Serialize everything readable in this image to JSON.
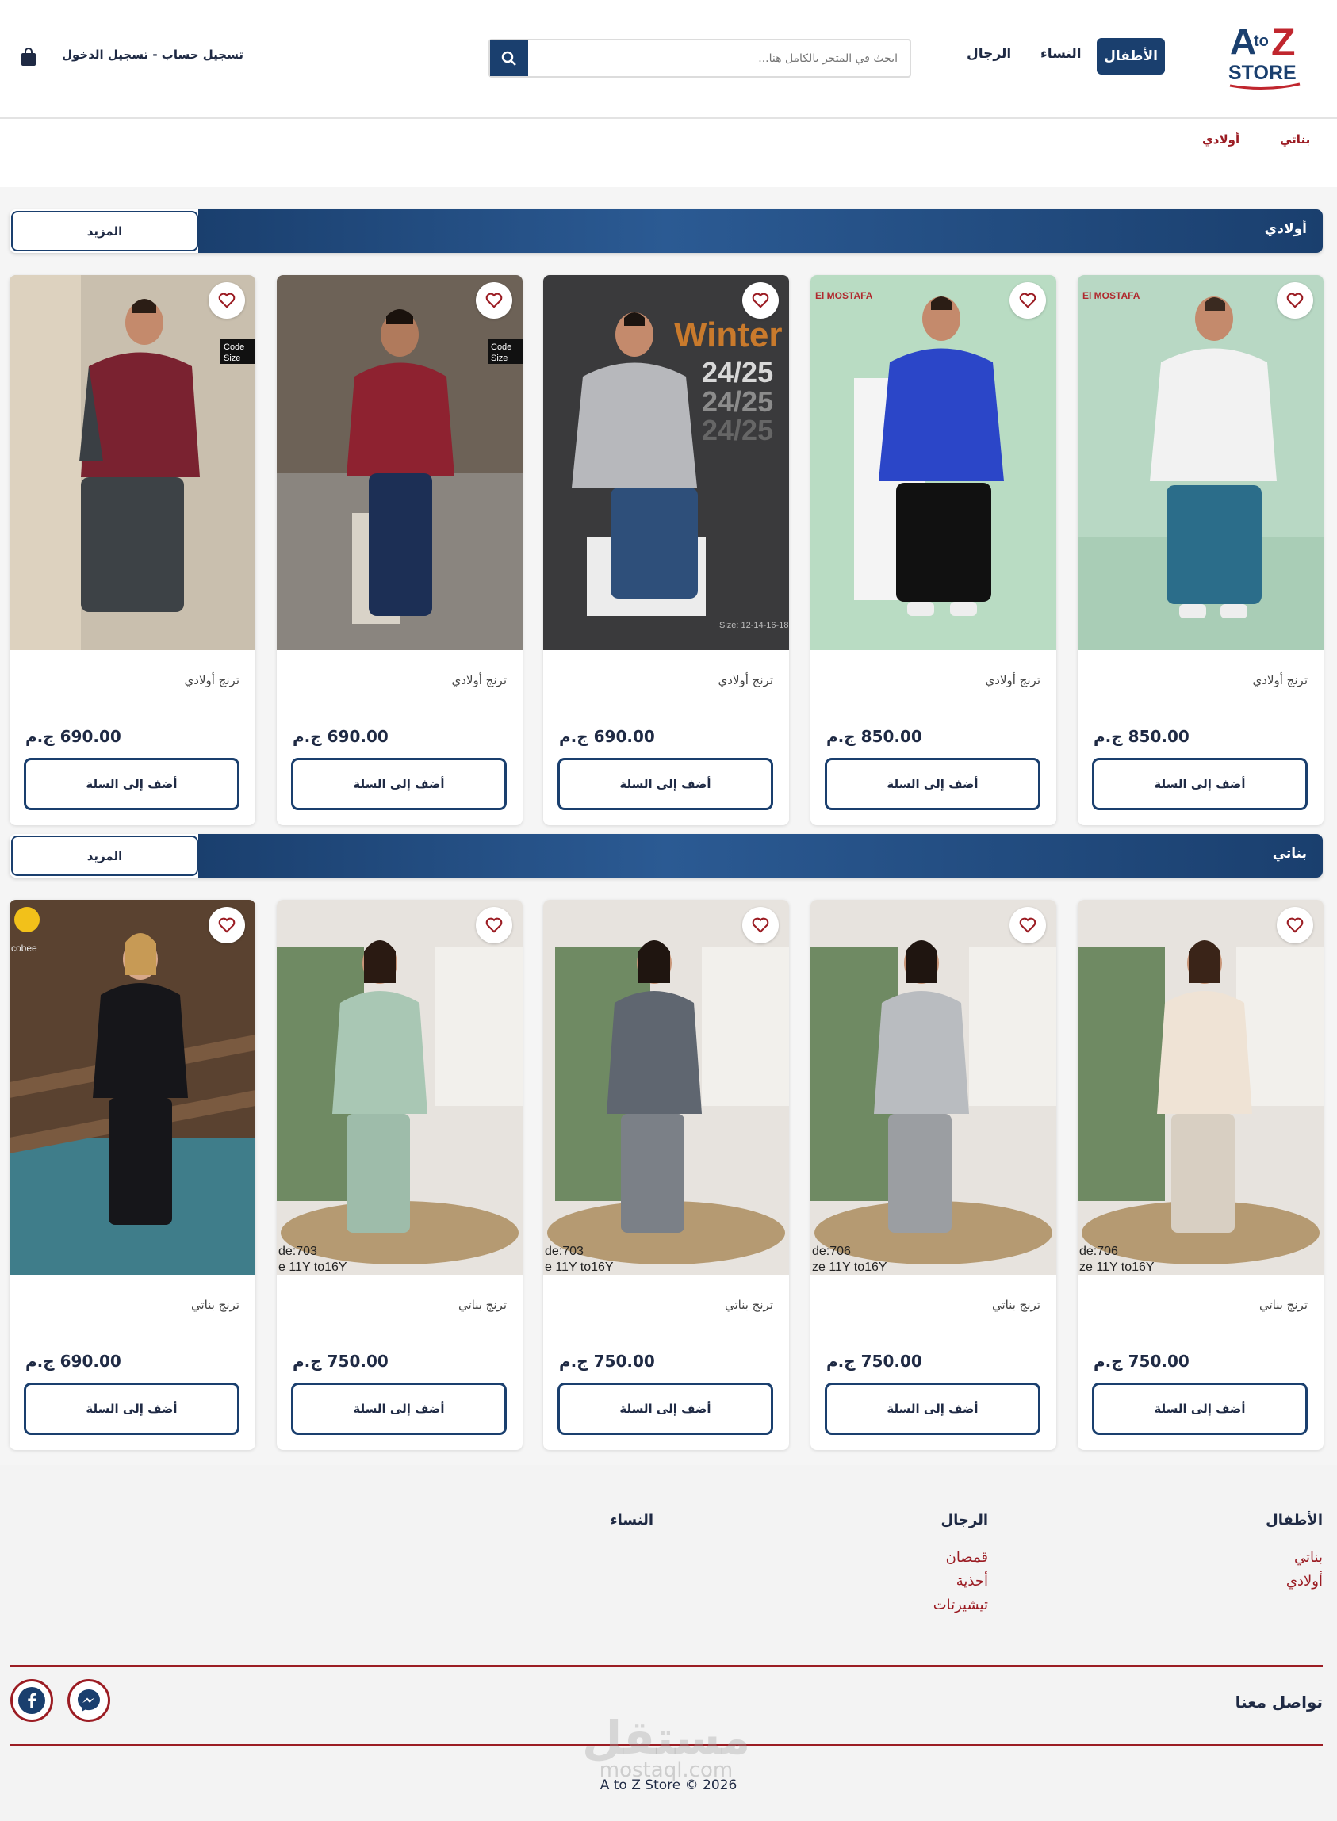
{
  "header": {
    "logo_main": "A",
    "logo_to": "to",
    "logo_z": "Z",
    "logo_store": "STORE",
    "nav": [
      "الأطفال",
      "النساء",
      "الرجال"
    ],
    "search": {
      "placeholder": "ابحث في المتجر بالكامل هنا..."
    },
    "login_label": "تسجيل حساب - تسجيل الدخول"
  },
  "subnav": [
    "بناتي",
    "أولادي"
  ],
  "sections": [
    {
      "title": "أولادي",
      "more_label": "المزيد",
      "products": [
        {
          "name": "ترنج أولادي",
          "price": "850.00 ج.م",
          "add_label": "أضف إلى السلة",
          "brand": "El MOSTAFA"
        },
        {
          "name": "ترنج أولادي",
          "price": "850.00 ج.م",
          "add_label": "أضف إلى السلة",
          "brand": "El MOSTAFA"
        },
        {
          "name": "ترنج أولادي",
          "price": "690.00 ج.م",
          "add_label": "أضف إلى السلة",
          "overlay": "Winter",
          "overlay2": "24/25",
          "size": "Size: 12-14-16-18"
        },
        {
          "name": "ترنج أولادي",
          "price": "690.00 ج.م",
          "add_label": "أضف إلى السلة",
          "badge1": "Code",
          "badge2": "Size"
        },
        {
          "name": "ترنج أولادي",
          "price": "690.00 ج.م",
          "add_label": "أضف إلى السلة",
          "badge1": "Code",
          "badge2": "Size"
        }
      ]
    },
    {
      "title": "بناتي",
      "more_label": "المزيد",
      "products": [
        {
          "name": "ترنج بناتي",
          "price": "750.00 ج.م",
          "add_label": "أضف إلى السلة",
          "code": "de:706",
          "size": "ze 11Y to16Y"
        },
        {
          "name": "ترنج بناتي",
          "price": "750.00 ج.م",
          "add_label": "أضف إلى السلة",
          "code": "de:706",
          "size": "ze 11Y to16Y"
        },
        {
          "name": "ترنج بناتي",
          "price": "750.00 ج.م",
          "add_label": "أضف إلى السلة",
          "code": "de:703",
          "size": "e 11Y to16Y"
        },
        {
          "name": "ترنج بناتي",
          "price": "750.00 ج.م",
          "add_label": "أضف إلى السلة",
          "code": "de:703",
          "size": "e 11Y to16Y"
        },
        {
          "name": "ترنج بناتي",
          "price": "690.00 ج.م",
          "add_label": "أضف إلى السلة",
          "brand": "cobee"
        }
      ]
    }
  ],
  "footer": {
    "columns": [
      {
        "title": "الأطفال",
        "links": [
          "بناتي",
          "أولادي"
        ]
      },
      {
        "title": "الرجال",
        "links": [
          "قمصان",
          "أحذية",
          "تيشيرتات"
        ]
      },
      {
        "title": "النساء",
        "links": []
      }
    ],
    "contact_title": "تواصل معنا",
    "copyright": "A to Z Store © 2026",
    "watermark": "مستقل",
    "watermark_sub": "mostaql.com"
  },
  "colors": {
    "primary": "#1a3f6e",
    "accent": "#9b1c23"
  }
}
